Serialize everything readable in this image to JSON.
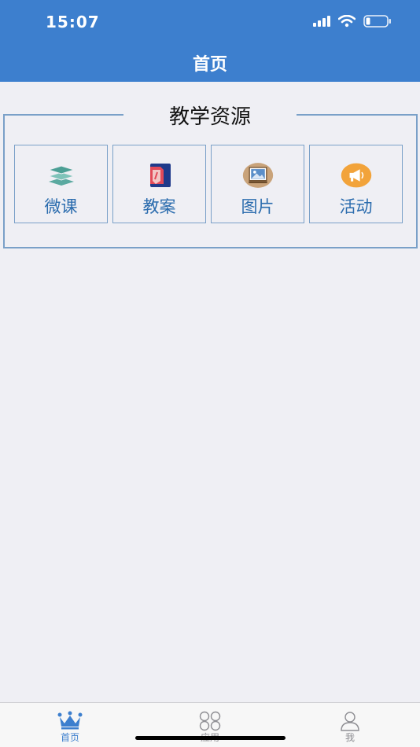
{
  "status_bar": {
    "time": "15:07"
  },
  "nav": {
    "title": "首页"
  },
  "section": {
    "title": "教学资源",
    "items": [
      {
        "label": "微课",
        "icon": "layers-icon"
      },
      {
        "label": "教案",
        "icon": "document-icon"
      },
      {
        "label": "图片",
        "icon": "picture-icon"
      },
      {
        "label": "活动",
        "icon": "megaphone-icon"
      }
    ]
  },
  "tabbar": {
    "items": [
      {
        "label": "首页",
        "icon": "crown-icon",
        "active": true
      },
      {
        "label": "应用",
        "icon": "apps-icon",
        "active": false
      },
      {
        "label": "我",
        "icon": "person-icon",
        "active": false
      }
    ]
  },
  "colors": {
    "brand": "#3d7fce",
    "tile_label": "#2b6cae",
    "active_tab": "#3d7fce",
    "inactive_tab": "#8e8e93"
  }
}
